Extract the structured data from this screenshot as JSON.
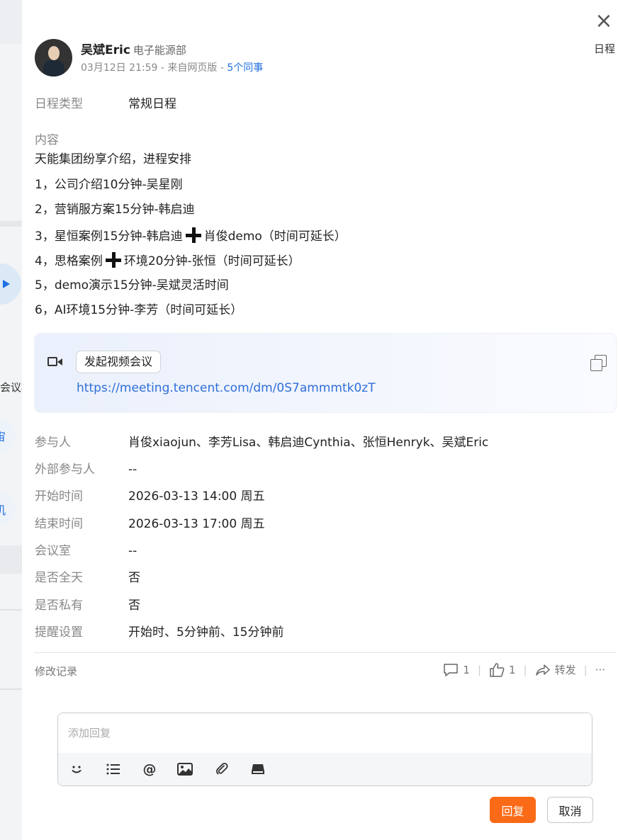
{
  "header": {
    "author_name": "吴斌Eric",
    "author_dept": "电子能源部",
    "post_time": "03月12日 21:59",
    "source": "来自网页版",
    "colleagues_link": "5个同事",
    "type_tag": "日程",
    "close_icon": "close-icon"
  },
  "schedule_type": {
    "label": "日程类型",
    "value": "常规日程"
  },
  "content": {
    "label": "内容",
    "line1": "天能集团纷享介绍，进程安排",
    "line2": "1，公司介绍10分钟-吴星刚",
    "line3": "2，营销服方案15分钟-韩启迪",
    "line4_a": "3，星恒案例15分钟-韩启迪",
    "line4_b": "肖俊demo（时间可延长）",
    "line5_a": "4，思格案例",
    "line5_b": "环境20分钟-张恒（时间可延长）",
    "line6": "5，demo演示15分钟-吴斌灵活时间",
    "line7": "6，AI环境15分钟-李芳（时间可延长）"
  },
  "video": {
    "button_label": "发起视频会议",
    "link": "https://meeting.tencent.com/dm/0S7ammmtk0zT",
    "camera_icon": "video-camera-icon",
    "copy_icon": "copy-icon"
  },
  "fields": [
    {
      "label": "参与人",
      "value": "肖俊xiaojun、李芳Lisa、韩启迪Cynthia、张恒Henryk、吴斌Eric"
    },
    {
      "label": "外部参与人",
      "value": "--"
    },
    {
      "label": "开始时间",
      "value": "2026-03-13 14:00 周五"
    },
    {
      "label": "结束时间",
      "value": "2026-03-13 17:00 周五"
    },
    {
      "label": "会议室",
      "value": "--"
    },
    {
      "label": "是否全天",
      "value": "否"
    },
    {
      "label": "是否私有",
      "value": "否"
    },
    {
      "label": "提醒设置",
      "value": "开始时、5分钟前、15分钟前"
    }
  ],
  "footer": {
    "edit_log": "修改记录",
    "comment_count": "1",
    "like_count": "1",
    "forward_label": "转发",
    "more_label": "···"
  },
  "reply": {
    "placeholder": "添加回复",
    "reply_button": "回复",
    "cancel_button": "取消"
  },
  "background": {
    "fragment1": "会议概",
    "fragment2": "宙",
    "fragment3": "机"
  },
  "colors": {
    "accent_orange": "#fb6a16",
    "link_blue": "#2f6ed8"
  }
}
